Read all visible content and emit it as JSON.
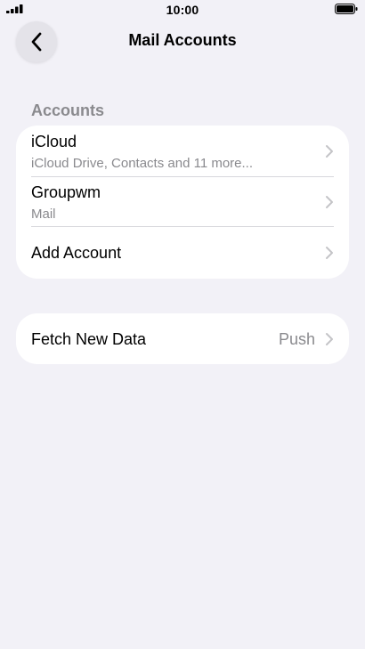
{
  "status_bar": {
    "time": "10:00",
    "icons": [
      "signal-icon",
      "battery-icon"
    ]
  },
  "nav": {
    "title": "Mail Accounts",
    "back_icon": "chevron-left-icon"
  },
  "accounts_section": {
    "header": "Accounts",
    "items": [
      {
        "title": "iCloud",
        "subtitle": "iCloud Drive, Contacts and 11 more..."
      },
      {
        "title": "Groupwm",
        "subtitle": "Mail"
      },
      {
        "title": "Add Account"
      }
    ]
  },
  "fetch": {
    "label": "Fetch New Data",
    "value": "Push"
  },
  "colors": {
    "background": "#f2f1f7",
    "card": "#ffffff",
    "secondary_text": "#8a8a8e",
    "chevron": "#c4c4c7"
  }
}
